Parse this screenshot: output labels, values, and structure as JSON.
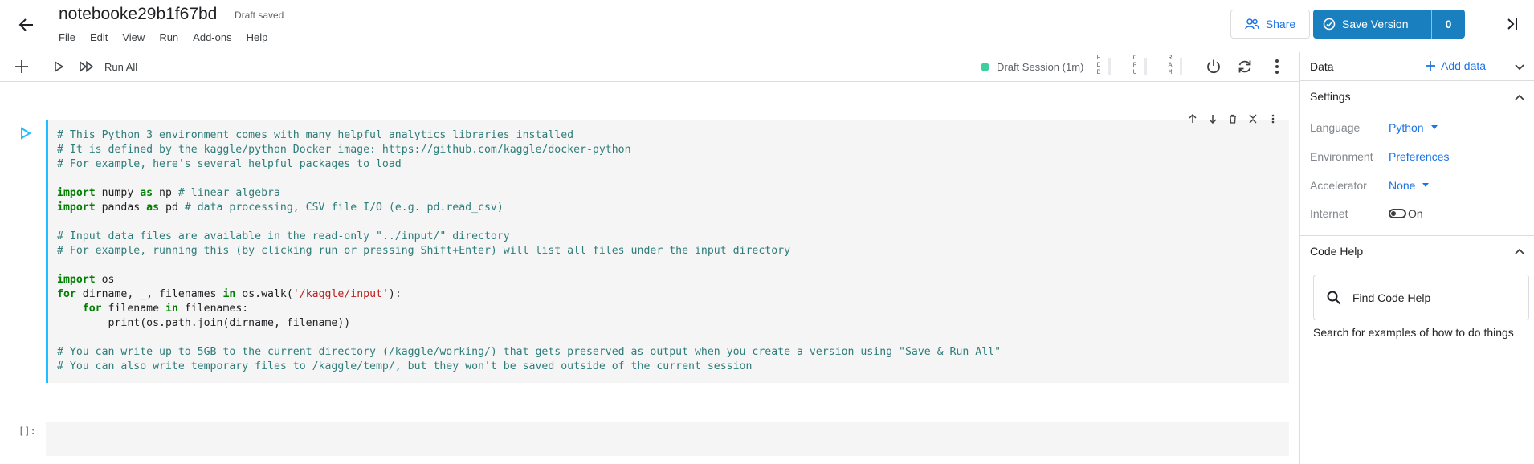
{
  "header": {
    "title": "notebooke29b1f67bd",
    "status": "Draft saved",
    "menu": [
      "File",
      "Edit",
      "View",
      "Run",
      "Add-ons",
      "Help"
    ],
    "share_label": "Share",
    "save_label": "Save Version",
    "version_count": "0"
  },
  "toolbar": {
    "run_all_label": "Run All",
    "session_label": "Draft Session (1m)",
    "meters": {
      "hdd": "HDD",
      "cpu": "CPU",
      "ram": "RAM"
    },
    "session_color": "#3ecf9e"
  },
  "cell": {
    "lines": [
      {
        "t": "# This Python 3 environment comes with many helpful analytics libraries installed"
      },
      {
        "t": "# It is defined by the kaggle/python Docker image: https://github.com/kaggle/docker-python"
      },
      {
        "t": "# For example, here's several helpful packages to load"
      },
      {
        "t": ""
      },
      {
        "t": "import numpy as np # linear algebra"
      },
      {
        "t": "import pandas as pd # data processing, CSV file I/O (e.g. pd.read_csv)"
      },
      {
        "t": ""
      },
      {
        "t": "# Input data files are available in the read-only \"../input/\" directory"
      },
      {
        "t": "# For example, running this (by clicking run or pressing Shift+Enter) will list all files under the input directory"
      },
      {
        "t": ""
      },
      {
        "t": "import os"
      },
      {
        "t": "for dirname, _, filenames in os.walk('/kaggle/input'):"
      },
      {
        "t": "    for filename in filenames:"
      },
      {
        "t": "        print(os.path.join(dirname, filename))"
      },
      {
        "t": ""
      },
      {
        "t": "# You can write up to 5GB to the current directory (/kaggle/working/) that gets preserved as output when you create a version using \"Save & Run All\""
      },
      {
        "t": "# You can also write temporary files to /kaggle/temp/, but they won't be saved outside of the current session"
      }
    ],
    "empty_prompt": "[]:"
  },
  "sidebar": {
    "data_label": "Data",
    "add_data_label": "Add data",
    "settings_label": "Settings",
    "settings": [
      {
        "key": "Language",
        "value": "Python",
        "dropdown": true
      },
      {
        "key": "Environment",
        "value": "Preferences",
        "dropdown": false
      },
      {
        "key": "Accelerator",
        "value": "None",
        "dropdown": true
      },
      {
        "key": "Internet",
        "value": "On",
        "toggle": true
      }
    ],
    "code_help_label": "Code Help",
    "find_placeholder": "Find Code Help",
    "help_hint": "Search for examples of how to do things"
  },
  "colors": {
    "accent": "#1a7fbf",
    "link": "#1a73e8",
    "cell_border": "#20beff"
  }
}
